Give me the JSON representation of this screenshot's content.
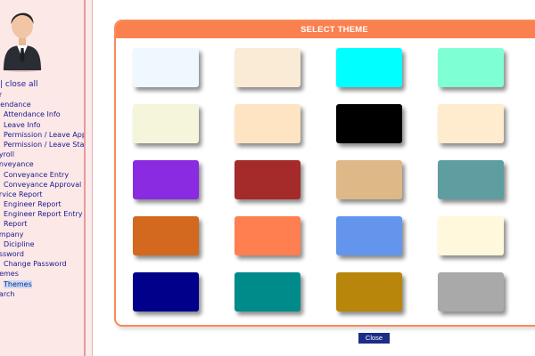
{
  "sidebar": {
    "expand_partial": "|",
    "collapse_all": "close all",
    "items": [
      {
        "label": "er",
        "level": 0
      },
      {
        "label": "ttendance",
        "level": 0
      },
      {
        "label": "Attendance Info",
        "level": 1
      },
      {
        "label": "Leave Info",
        "level": 1
      },
      {
        "label": "Permission / Leave Apply",
        "level": 1
      },
      {
        "label": "Permission / Leave Status",
        "level": 1
      },
      {
        "label": "ayroll",
        "level": 0
      },
      {
        "label": "onveyance",
        "level": 0
      },
      {
        "label": "Conveyance Entry",
        "level": 1
      },
      {
        "label": "Conveyance Approval",
        "level": 1
      },
      {
        "label": "ervice Report",
        "level": 0
      },
      {
        "label": "Engineer Report",
        "level": 1
      },
      {
        "label": "Engineer Report Entry",
        "level": 1
      },
      {
        "label": "Report",
        "level": 1
      },
      {
        "label": "ompany",
        "level": 0
      },
      {
        "label": "Dicipline",
        "level": 1
      },
      {
        "label": "assword",
        "level": 0
      },
      {
        "label": "Change Password",
        "level": 1
      },
      {
        "label": "hemes",
        "level": 0
      },
      {
        "label": "Themes",
        "level": 1,
        "selected": true
      },
      {
        "label": "earch",
        "level": 0
      }
    ]
  },
  "theme_panel": {
    "title": "SELECT THEME",
    "swatches": [
      {
        "name": "aliceblue",
        "color": "#f0f8ff"
      },
      {
        "name": "antiquewhite",
        "color": "#faebd7"
      },
      {
        "name": "aqua",
        "color": "#00ffff"
      },
      {
        "name": "aquamarine",
        "color": "#7fffd4"
      },
      {
        "name": "beige",
        "color": "#f5f5dc"
      },
      {
        "name": "bisque",
        "color": "#ffe4c4"
      },
      {
        "name": "black",
        "color": "#000000"
      },
      {
        "name": "blanchedalmond",
        "color": "#ffebcd"
      },
      {
        "name": "blueviolet",
        "color": "#8a2be2"
      },
      {
        "name": "brown",
        "color": "#a52a2a"
      },
      {
        "name": "burlywood",
        "color": "#deb887"
      },
      {
        "name": "cadetblue",
        "color": "#5f9ea0"
      },
      {
        "name": "chocolate",
        "color": "#d2691e"
      },
      {
        "name": "coral",
        "color": "#ff7f50"
      },
      {
        "name": "cornflowerblue",
        "color": "#6495ed"
      },
      {
        "name": "cornsilk",
        "color": "#fff8dc"
      },
      {
        "name": "darkblue",
        "color": "#00008b"
      },
      {
        "name": "darkcyan",
        "color": "#008b8b"
      },
      {
        "name": "darkgoldenrod",
        "color": "#b8860b"
      },
      {
        "name": "darkgray",
        "color": "#a9a9a9"
      }
    ]
  },
  "footer": {
    "close_label": "Close"
  },
  "colors": {
    "accent": "#fa8050",
    "sidebar_bg": "#fde8e8",
    "link": "#1a1a8a",
    "button": "#1c2c88"
  },
  "icons": {
    "avatar": "user-avatar-icon"
  }
}
